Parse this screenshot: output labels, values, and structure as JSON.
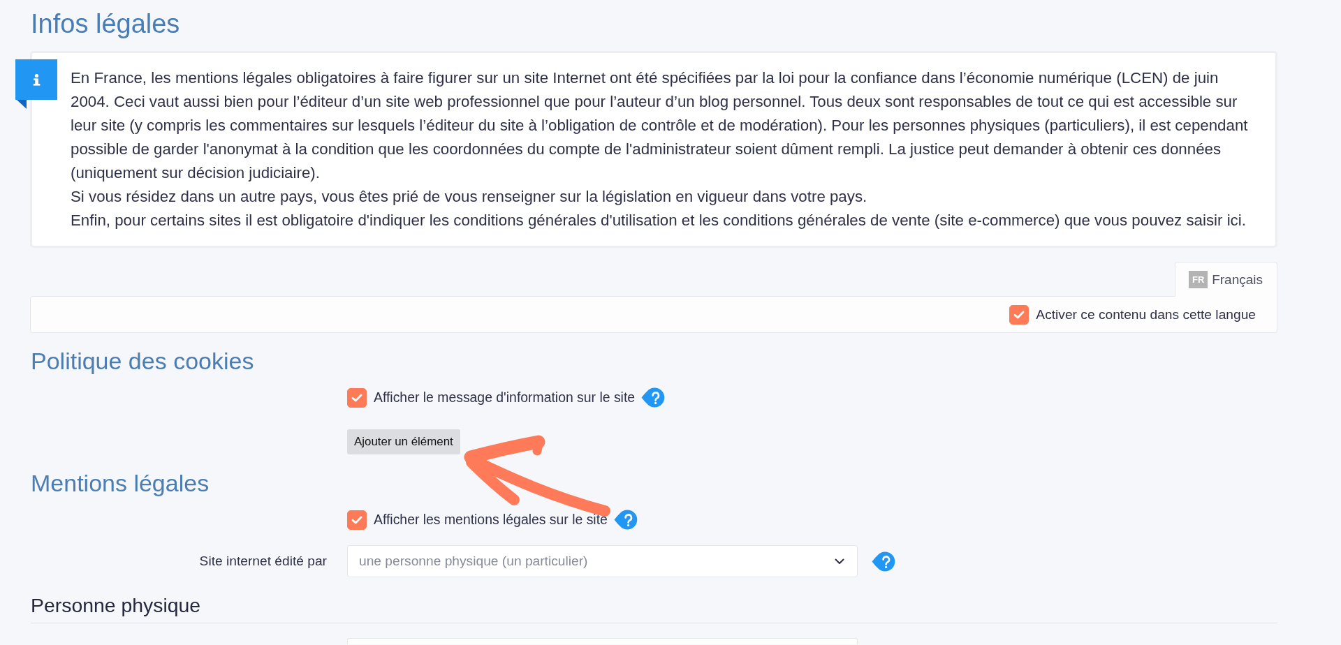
{
  "page_title": "Infos légales",
  "info_box": {
    "paragraphs": [
      "En France, les mentions légales obligatoires à faire figurer sur un site Internet ont été spécifiées par la loi pour la confiance dans l’économie numérique (LCEN) de juin 2004. Ceci vaut aussi bien pour l’éditeur d’un site web professionnel que pour l’auteur d’un blog personnel. Tous deux sont responsables de tout ce qui est accessible sur leur site (y compris les commentaires sur lesquels l’éditeur du site à l’obligation de contrôle et de modération). Pour les personnes physiques (particuliers), il est cependant possible de garder l'anonymat à la condition que les coordonnées du compte de l'administrateur soient dûment rempli. La justice peut demander à obtenir ces données (uniquement sur décision judiciaire).",
      "Si vous résidez dans un autre pays, vous êtes prié de vous renseigner sur la législation en vigueur dans votre pays.",
      "Enfin, pour certains sites il est obligatoire d'indiquer les conditions générales d'utilisation et les conditions générales de vente (site e-commerce) que vous pouvez saisir ici."
    ]
  },
  "language": {
    "tabs": [
      {
        "code": "FR",
        "label": "Français",
        "selected": true
      }
    ],
    "activate_option": {
      "label": "Activer ce contenu dans cette langue",
      "checked": true
    }
  },
  "cookie_policy": {
    "title": "Politique des cookies",
    "options": [
      {
        "label": "Afficher le message d'information sur le site",
        "checked": true
      }
    ],
    "add_button": "Ajouter un élément"
  },
  "legal_notice": {
    "title": "Mentions légales",
    "options": [
      {
        "label": "Afficher les mentions légales sur le site",
        "checked": true
      }
    ],
    "fields": [
      {
        "label": "Site internet édité par",
        "value": "une personne physique (un particulier)"
      }
    ]
  },
  "natural_person": {
    "title": "Personne physique"
  },
  "annotations": [
    {
      "kind": "arrow"
    }
  ]
}
